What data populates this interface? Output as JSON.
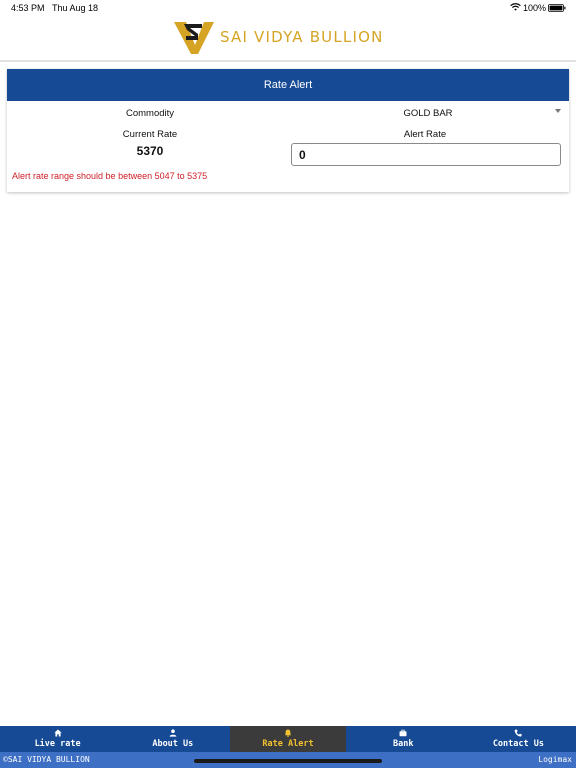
{
  "status_bar": {
    "time": "4:53 PM",
    "date": "Thu Aug 18",
    "battery": "100%"
  },
  "header": {
    "brand": "SAI VIDYA BULLION",
    "brand_color": "#d6a424"
  },
  "rate_alert": {
    "title": "Rate Alert",
    "commodity_label": "Commodity",
    "commodity_value": "GOLD BAR",
    "current_rate_label": "Current Rate",
    "current_rate_value": "5370",
    "alert_rate_label": "Alert Rate",
    "alert_rate_value": "0",
    "error_message": "Alert rate range should be between 5047 to 5375",
    "error_color": "#d0202a"
  },
  "nav": {
    "items": [
      {
        "label": "Live rate",
        "icon": "home-icon",
        "active": false
      },
      {
        "label": "About Us",
        "icon": "person-icon",
        "active": false
      },
      {
        "label": "Rate Alert",
        "icon": "bell-icon",
        "active": true
      },
      {
        "label": "Bank",
        "icon": "briefcase-icon",
        "active": false
      },
      {
        "label": "Contact Us",
        "icon": "phone-icon",
        "active": false
      }
    ],
    "accent": "#164a94",
    "active_color": "#f2c12e"
  },
  "footer": {
    "copyright": "©SAI VIDYA BULLION",
    "credit": "Logimax"
  }
}
